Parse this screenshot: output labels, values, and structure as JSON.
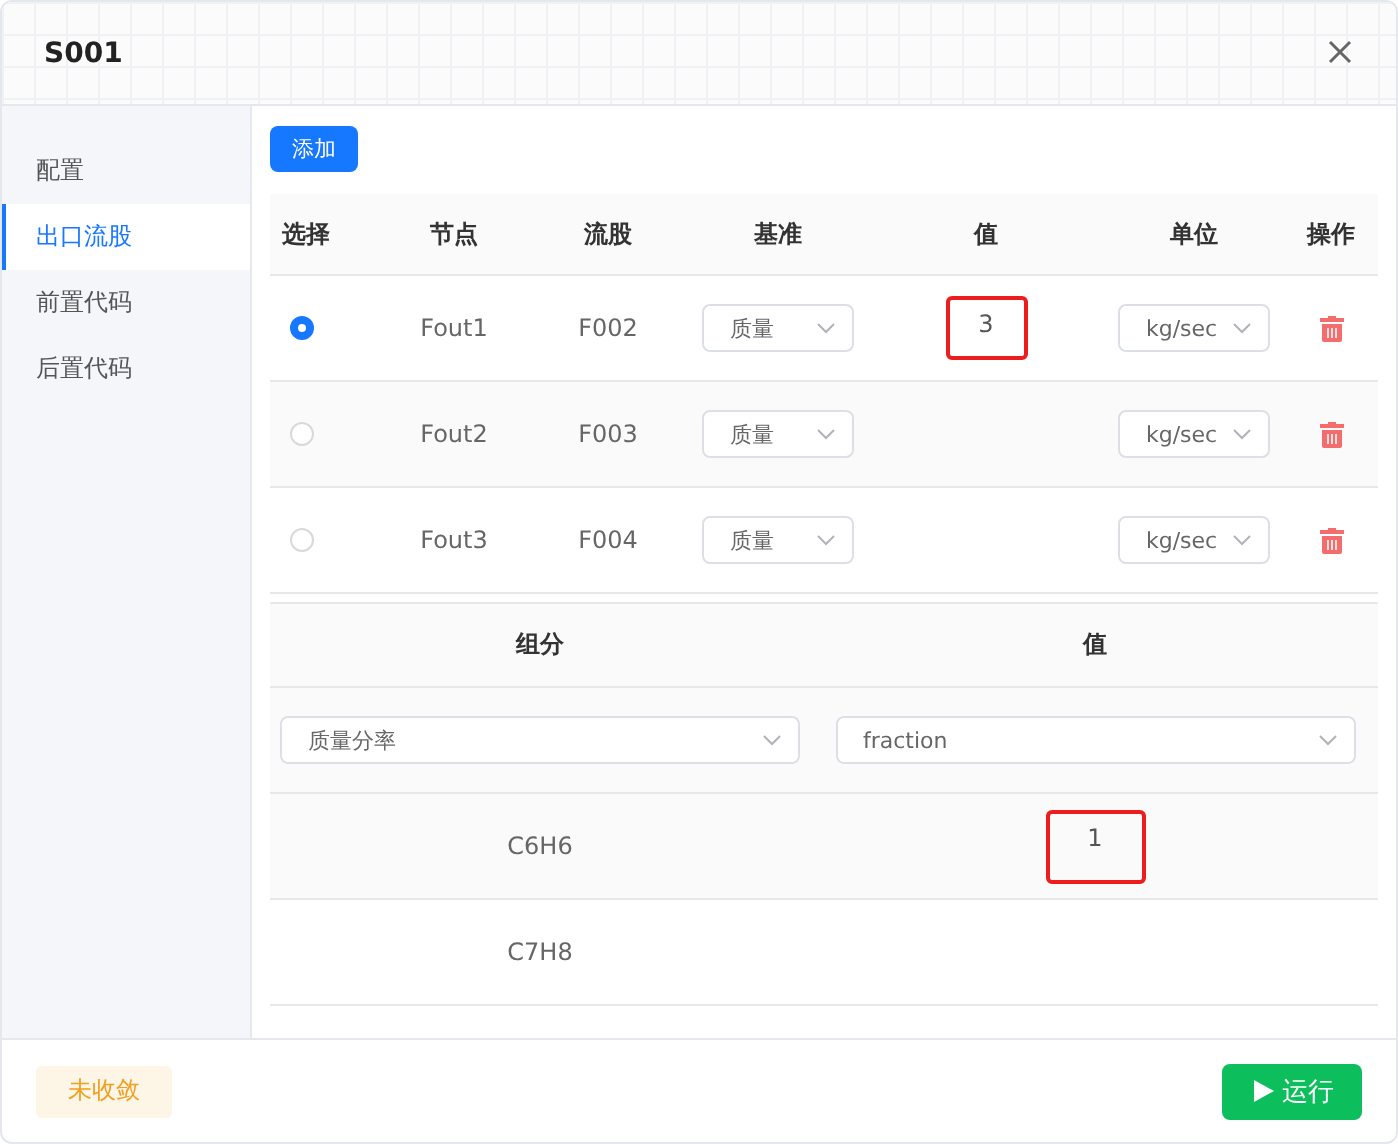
{
  "dialog": {
    "title": "S001"
  },
  "sidebar": {
    "items": [
      {
        "label": "配置",
        "selected": false
      },
      {
        "label": "出口流股",
        "selected": true
      },
      {
        "label": "前置代码",
        "selected": false
      },
      {
        "label": "后置代码",
        "selected": false
      }
    ]
  },
  "add_button": "添加",
  "streams": {
    "columns": [
      "选择",
      "节点",
      "流股",
      "基准",
      "值",
      "单位",
      "操作"
    ],
    "rows": [
      {
        "selected": true,
        "node": "Fout1",
        "stream": "F002",
        "basis": "质量",
        "value": "3",
        "value_highlighted": true,
        "unit": "kg/sec"
      },
      {
        "selected": false,
        "node": "Fout2",
        "stream": "F003",
        "basis": "质量",
        "unit": "kg/sec"
      },
      {
        "selected": false,
        "node": "Fout3",
        "stream": "F004",
        "basis": "质量",
        "unit": "kg/sec"
      }
    ]
  },
  "composition": {
    "columns": [
      "组分",
      "值"
    ],
    "basis": "质量分率",
    "unit": "fraction",
    "rows": [
      {
        "component": "C6H6",
        "value": "1",
        "value_highlighted": true
      },
      {
        "component": "C7H8"
      }
    ]
  },
  "footer": {
    "status": "未收敛",
    "run_button": "运行"
  }
}
